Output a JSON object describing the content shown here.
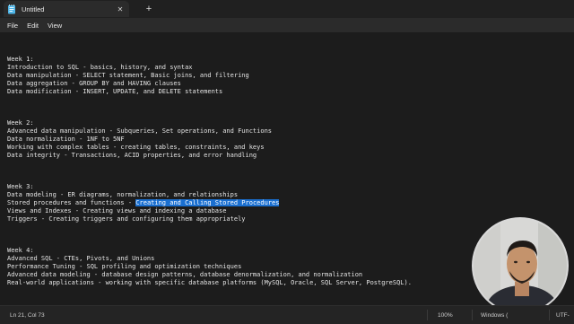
{
  "window": {
    "tab_title": "Untitled",
    "tab_close_icon": "close-icon",
    "new_tab_icon": "plus-icon",
    "app_icon": "notepad-icon"
  },
  "menu": {
    "file": "File",
    "edit": "Edit",
    "view": "View"
  },
  "editor": {
    "lines": [
      "Week 1:",
      "Introduction to SQL - basics, history, and syntax",
      "Data manipulation - SELECT statement, Basic joins, and filtering",
      "Data aggregation - GROUP BY and HAVING clauses",
      "Data modification - INSERT, UPDATE, and DELETE statements",
      "",
      "",
      "",
      "Week 2:",
      "Advanced data manipulation - Subqueries, Set operations, and Functions",
      "Data normalization - 1NF to 5NF",
      "Working with complex tables - creating tables, constraints, and keys",
      "Data integrity - Transactions, ACID properties, and error handling",
      "",
      "",
      "",
      "Week 3:",
      "Data modeling - ER diagrams, normalization, and relationships",
      {
        "before": "Stored procedures and functions - ",
        "selected": "Creating and Calling Stored Procedures",
        "after": ""
      },
      "Views and Indexes - Creating views and indexing a database",
      "Triggers - Creating triggers and configuring them appropriately",
      "",
      "",
      "",
      "Week 4:",
      "Advanced SQL - CTEs, Pivots, and Unions",
      "Performance Tuning - SQL profiling and optimization techniques",
      "Advanced data modeling - database design patterns, database denormalization, and normalization",
      "Real-world applications - working with specific database platforms (MySQL, Oracle, SQL Server, PostgreSQL)."
    ]
  },
  "status": {
    "position": "Ln 21, Col 73",
    "zoom": "100%",
    "line_ending": "Windows (",
    "encoding": "UTF-"
  },
  "colors": {
    "selection": "#1a6fd0",
    "background": "#1c1c1c"
  }
}
